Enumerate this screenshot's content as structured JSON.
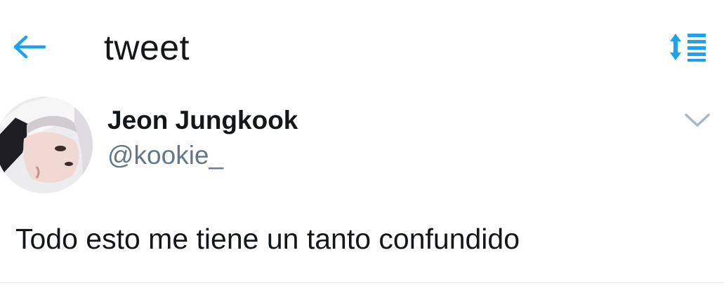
{
  "header": {
    "title": "tweet",
    "back_icon": "back-arrow-icon",
    "sort_icon": "sort-list-icon"
  },
  "tweet": {
    "author_name": "Jeon Jungkook",
    "author_handle": "@kookie_",
    "text": "Todo esto me tiene un tanto confundido",
    "menu_icon": "chevron-down-icon"
  },
  "colors": {
    "accent": "#1da1f2",
    "text_primary": "#14171a",
    "text_secondary": "#657786",
    "chevron": "#aab8c2",
    "divider": "#e6ecf0"
  }
}
